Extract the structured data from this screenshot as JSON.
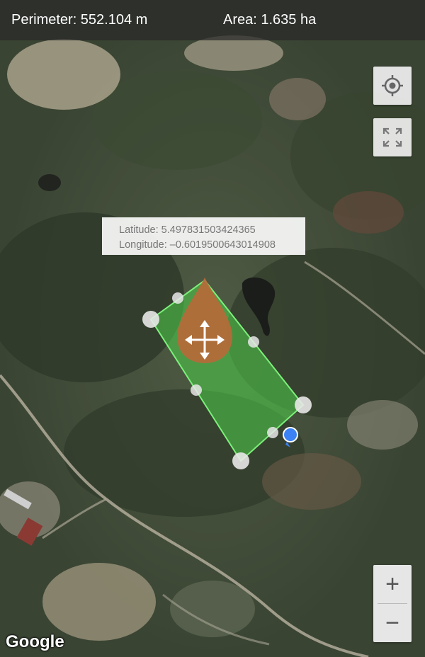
{
  "header": {
    "perimeter": "Perimeter: 552.104 m",
    "area": "Area: 1.635 ha"
  },
  "tooltip": {
    "latitude": "Latitude: 5.497831503424365",
    "longitude": "Longitude: –0.6019500643014908"
  },
  "controls": {
    "locate_icon": "crosshair-icon",
    "fullscreen_icon": "fullscreen-icon",
    "zoom_in": "+",
    "zoom_out": "−"
  },
  "attribution": "Google",
  "colors": {
    "polygon_fill": "#4fd14a",
    "polygon_stroke": "#7cf07a",
    "drag_marker": "#b66a3a",
    "location_dot": "#3b82f6"
  }
}
